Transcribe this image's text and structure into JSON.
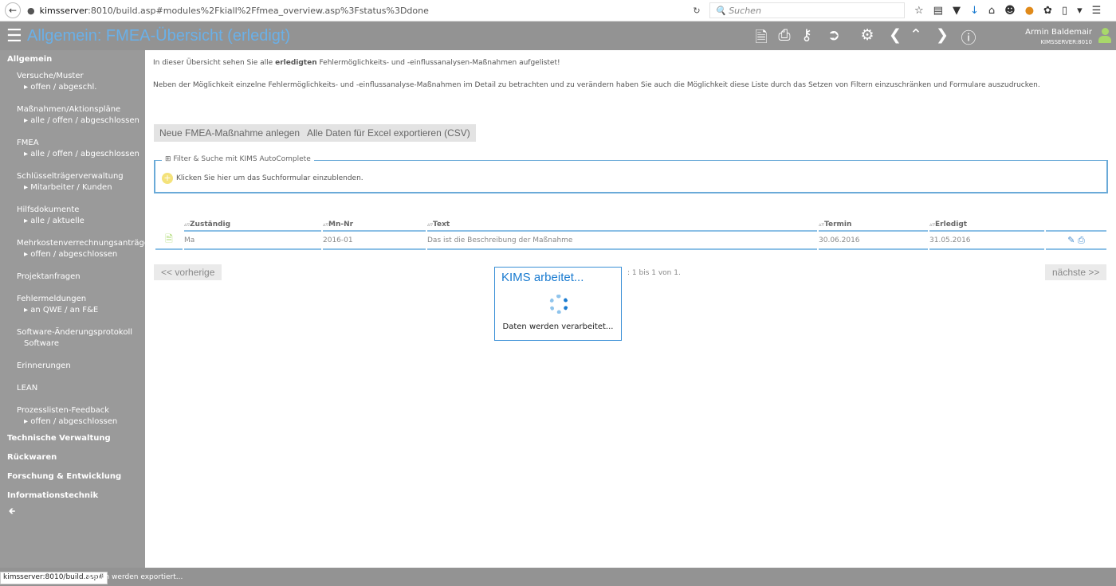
{
  "browser": {
    "url_host": "kimsserver",
    "url_rest": ":8010/build.asp#modules%2Fkiall%2Ffmea_overview.asp%3Fstatus%3Ddone",
    "search_placeholder": "Suchen"
  },
  "header": {
    "title": "Allgemein: FMEA-Übersicht (erledigt)",
    "user_name": "Armin Baldemair",
    "server": "KIMSSERVER:8010",
    "accent": "#6ab0e8"
  },
  "sidebar": {
    "groups": [
      {
        "label": "Allgemein"
      },
      {
        "label": "Technische Verwaltung"
      },
      {
        "label": "Rückwaren"
      },
      {
        "label": "Forschung & Entwicklung"
      },
      {
        "label": "Informationstechnik"
      }
    ],
    "items": [
      {
        "label": "Versuche/Muster",
        "sub": "offen / abgeschl."
      },
      {
        "label": "Maßnahmen/Aktionspläne",
        "sub": "alle / offen / abgeschlossen"
      },
      {
        "label": "FMEA",
        "sub": "alle / offen / abgeschlossen"
      },
      {
        "label": "Schlüsselträgerverwaltung",
        "sub": "Mitarbeiter / Kunden"
      },
      {
        "label": "Hilfsdokumente",
        "sub": "alle / aktuelle"
      },
      {
        "label": "Mehrkostenverrechnungsanträge",
        "sub": "offen / abgeschlossen"
      },
      {
        "label": "Projektanfragen"
      },
      {
        "label": "Fehlermeldungen",
        "sub": "an QWE / an F&E"
      },
      {
        "label": "Software-Änderungsprotokoll",
        "sub": "Software"
      },
      {
        "label": "Erinnerungen"
      },
      {
        "label": "LEAN"
      },
      {
        "label": "Prozesslisten-Feedback",
        "sub": "offen / abgeschlossen"
      }
    ]
  },
  "main": {
    "intro_pre": "In dieser Übersicht sehen Sie alle ",
    "intro_bold": "erledigten",
    "intro_post": " Fehlermöglichkeits- und -einflussanalysen-Maßnahmen aufgelistet!",
    "intro2": "Neben der Möglichkeit einzelne Fehlermöglichkeits- und -einflussanalyse-Maßnahmen im Detail zu betrachten und zu verändern haben Sie auch die Möglichkeit diese Liste durch das Setzen von Filtern einzuschränken und Formulare auszudrucken.",
    "btn_new": "Neue FMEA-Maßnahme anlegen",
    "btn_export": "Alle Daten für Excel exportieren (CSV)",
    "filter_legend": "Filter & Suche mit KIMS AutoComplete",
    "filter_hint": "Klicken Sie hier um das Suchformular einzublenden.",
    "columns": [
      "Zuständig",
      "Mn-Nr",
      "Text",
      "Termin",
      "Erledigt"
    ],
    "rows": [
      {
        "zustaendig": "Ma",
        "mn_nr": "2016-01",
        "text": "Das ist die Beschreibung der Maßnahme",
        "termin": "30.06.2016",
        "erledigt": "31.05.2016"
      }
    ],
    "prev": "<< vorherige",
    "next": "nächste >>",
    "info": ": 1 bis 1 von 1."
  },
  "dialog": {
    "title": "KIMS arbeitet...",
    "text": "Daten werden verarbeitet..."
  },
  "status": {
    "link": "kimsserver:8010/build.asp#",
    "message": "Daten werden exportiert..."
  }
}
